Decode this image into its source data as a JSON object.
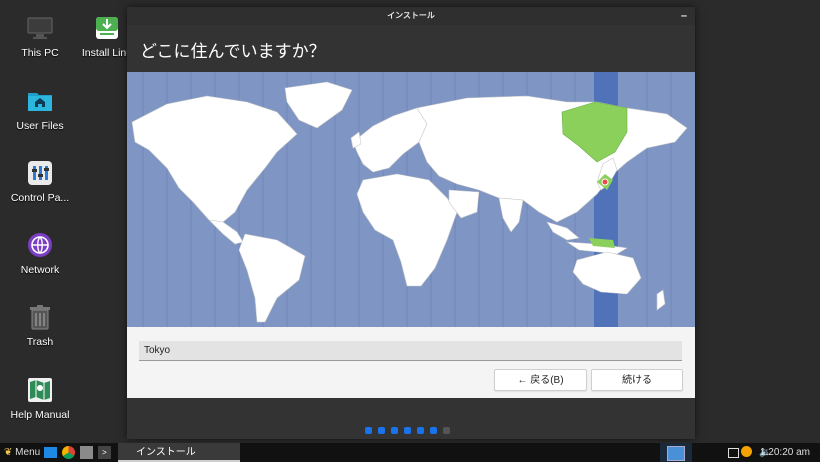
{
  "desktop": {
    "icons": [
      {
        "label": "This PC"
      },
      {
        "label": "Install Linu"
      },
      {
        "label": "User Files"
      },
      {
        "label": "Control Pa..."
      },
      {
        "label": "Network"
      },
      {
        "label": "Trash"
      },
      {
        "label": "Help Manual"
      }
    ]
  },
  "window": {
    "title": "インストール",
    "minimize_symbol": "–",
    "question": "どこに住んでいますか？",
    "timezone_value": "Tokyo",
    "back_label": "← 戻る(B)",
    "next_label": "続ける",
    "progress": {
      "total": 7,
      "current": 6
    }
  },
  "taskbar": {
    "menu_label": "Menu",
    "window_label": "インストール",
    "clock": "1:20:20 am"
  },
  "colors": {
    "ocean": "#7f96c5",
    "highlight_zone": "#4f72b8",
    "selected_region": "#8ad05a",
    "accent": "#1a73e8"
  }
}
